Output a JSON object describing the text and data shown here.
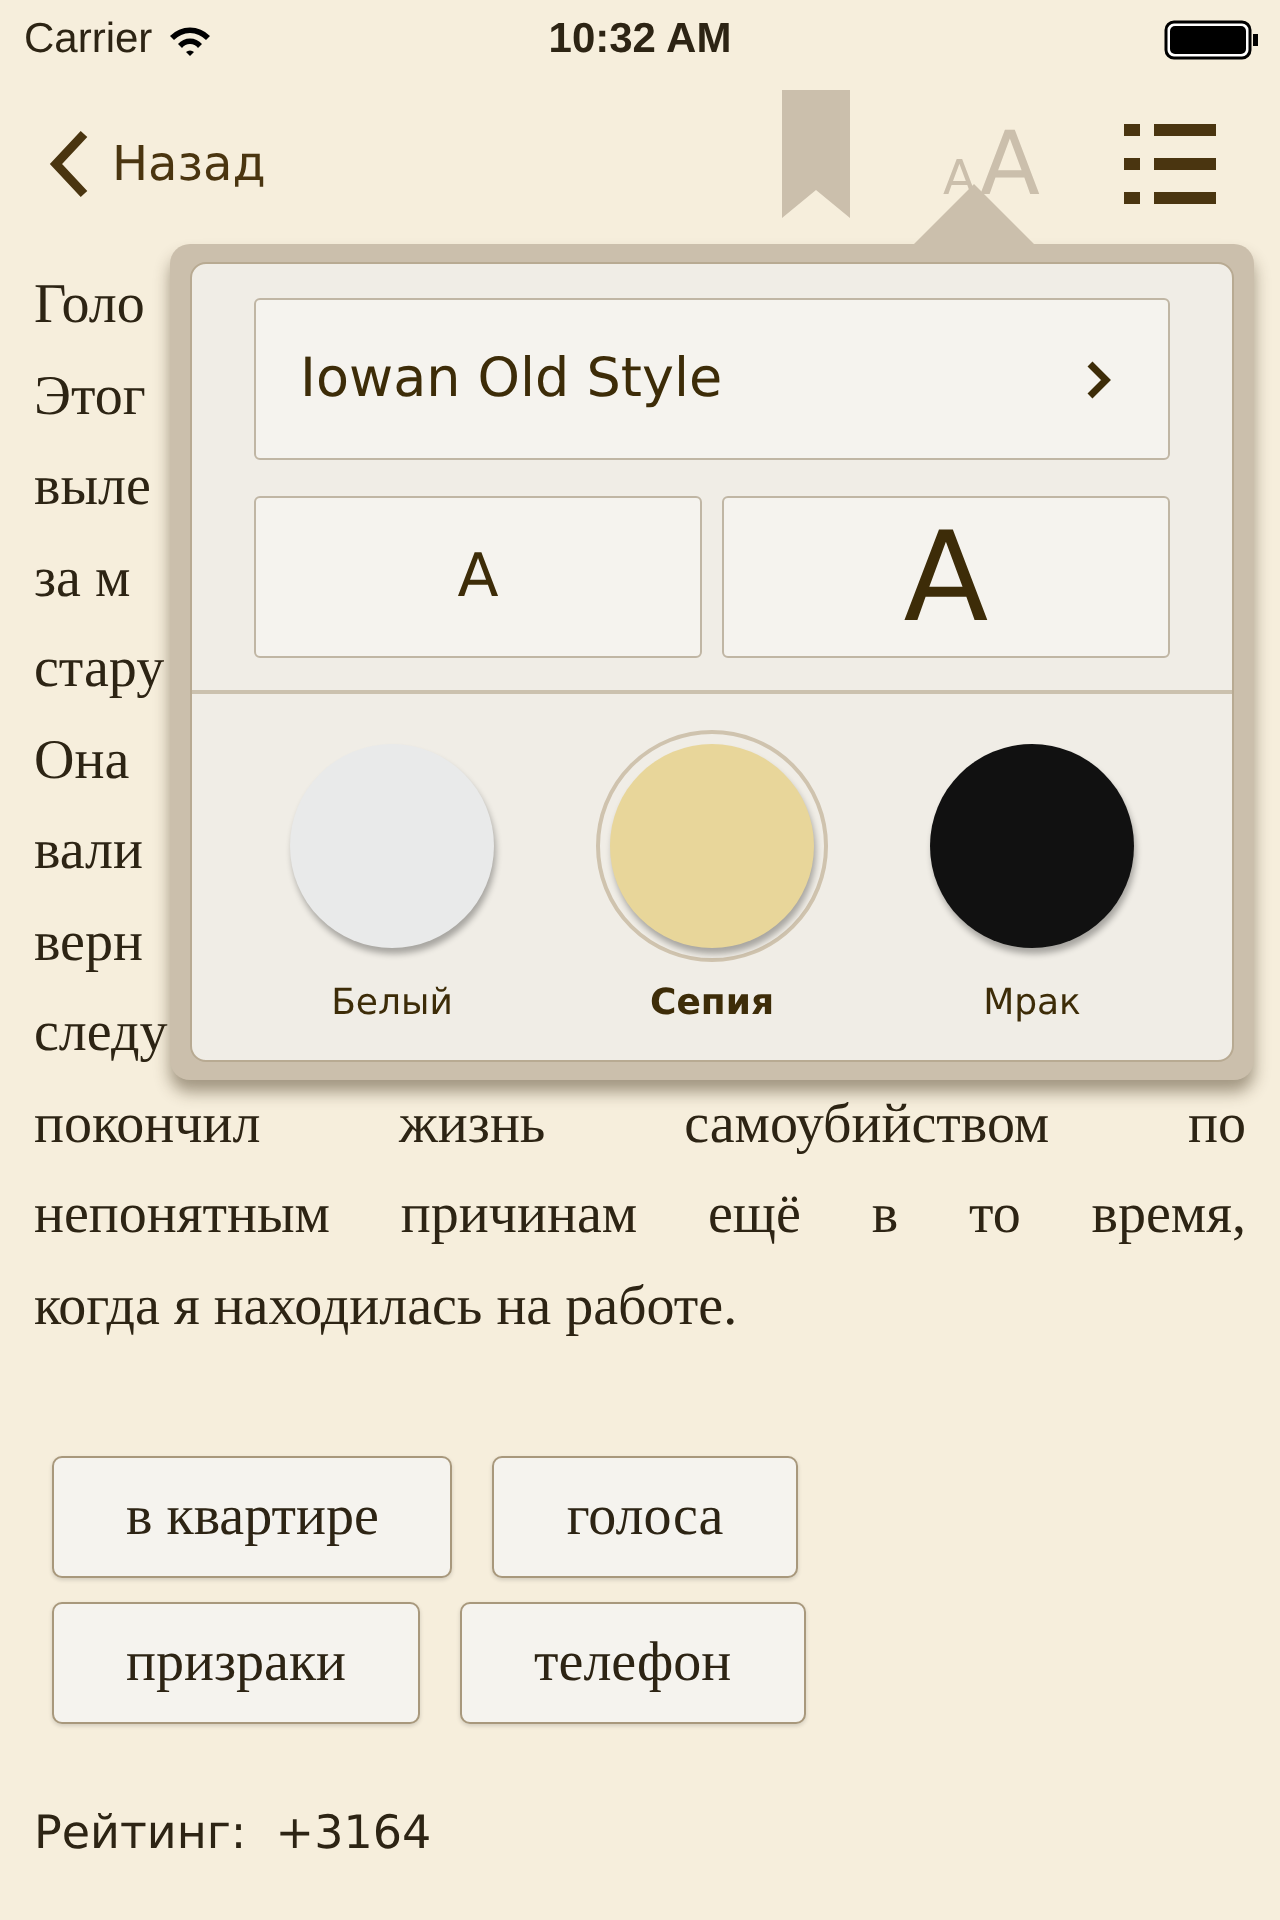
{
  "status_bar": {
    "carrier": "Carrier",
    "time": "10:32 AM"
  },
  "nav_bar": {
    "back": "Назад",
    "font_button": {
      "small": "A",
      "large": "A"
    }
  },
  "body_lines": [
    {
      "text": "Голо",
      "kind": "fragment"
    },
    {
      "text": "Этог",
      "kind": "fragment"
    },
    {
      "text": "выле",
      "kind": "fragment"
    },
    {
      "text": "за м",
      "kind": "fragment"
    },
    {
      "text": "стару",
      "kind": "fragment"
    },
    {
      "text": "Она",
      "kind": "fragment"
    },
    {
      "text": "вали",
      "kind": "fragment"
    },
    {
      "text": "верн",
      "kind": "fragment"
    },
    {
      "text": "следу",
      "kind": "fragment"
    },
    {
      "text": "покончил жизнь самоубийством по",
      "kind": "justified"
    },
    {
      "text": "непонятным причинам ещё в то время,",
      "kind": "justified"
    },
    {
      "text": "когда я находилась на работе.",
      "kind": "last"
    }
  ],
  "popover": {
    "font_name": "Iowan Old Style",
    "size_buttons": [
      {
        "kind": "smaller",
        "label": "A"
      },
      {
        "kind": "larger",
        "label": "A"
      }
    ],
    "themes": [
      {
        "label": "Белый",
        "color": "#e9eaea",
        "selected": false
      },
      {
        "label": "Сепия",
        "color": "#e8d69a",
        "selected": true
      },
      {
        "label": "Мрак",
        "color": "#111111",
        "selected": false
      }
    ]
  },
  "tag_rows": [
    [
      "в квартире",
      "голоса"
    ],
    [
      "призраки",
      "телефон"
    ]
  ],
  "rating": "Рейтинг:  +3164"
}
